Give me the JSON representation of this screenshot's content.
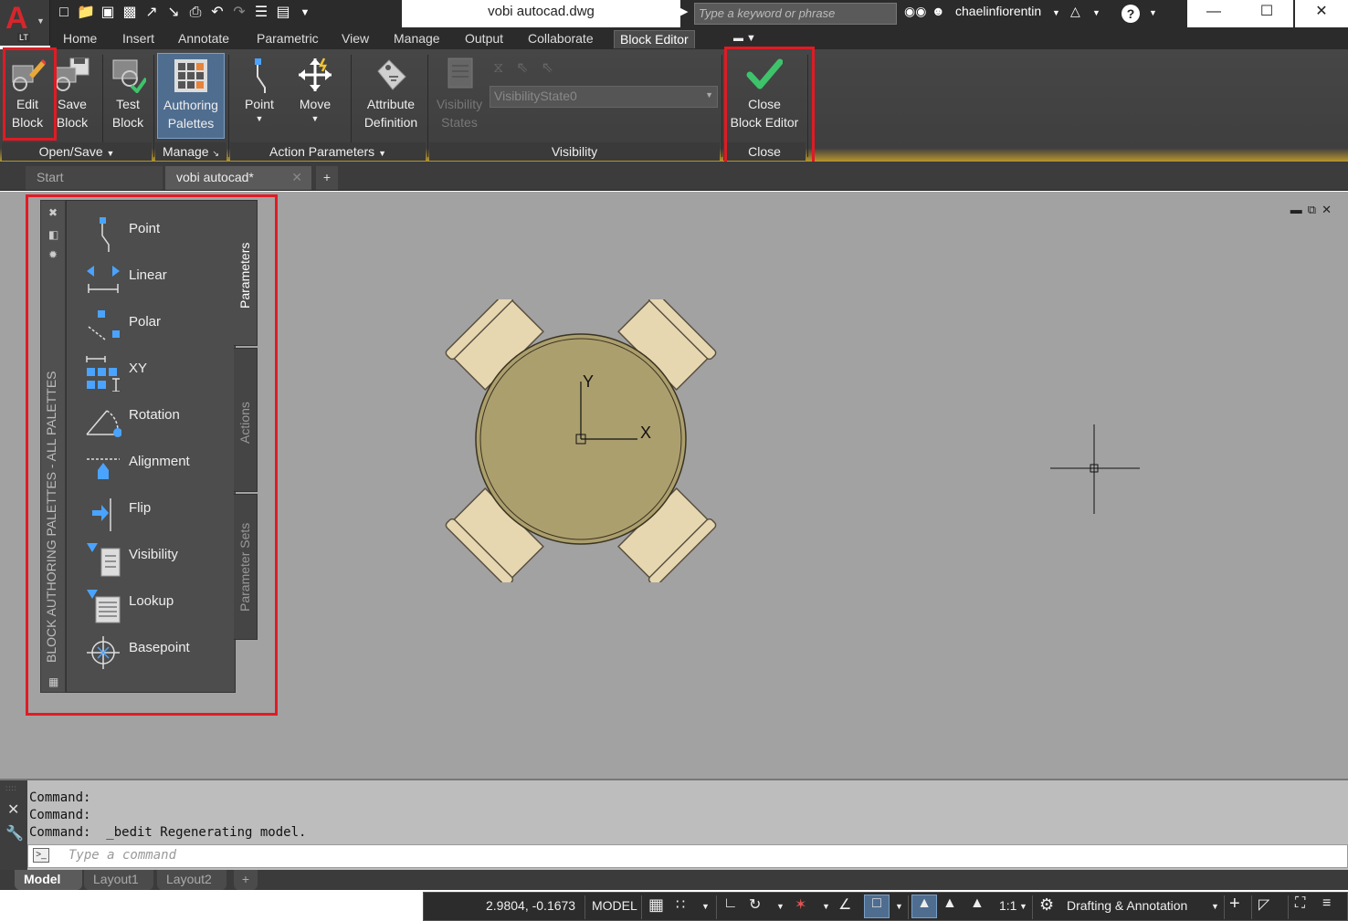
{
  "titlebar": {
    "app_letter": "A",
    "app_edition": "LT",
    "document_title": "vobi autocad.dwg",
    "search_placeholder": "Type a keyword or phrase",
    "username": "chaelinfiorentin"
  },
  "ribbon_tabs": [
    "Home",
    "Insert",
    "Annotate",
    "Parametric",
    "View",
    "Manage",
    "Output",
    "Collaborate",
    "Block Editor"
  ],
  "active_ribbon_tab": "Block Editor",
  "ribbon": {
    "edit_block": [
      "Edit",
      "Block"
    ],
    "save_block": [
      "Save",
      "Block"
    ],
    "test_block": [
      "Test",
      "Block"
    ],
    "authoring_palettes": [
      "Authoring",
      "Palettes"
    ],
    "point": "Point",
    "move": "Move",
    "attribute_definition": [
      "Attribute",
      "Definition"
    ],
    "visibility_states": [
      "Visibility",
      "States"
    ],
    "visibility_state_value": "VisibilityState0",
    "close_block_editor": [
      "Close",
      "Block Editor"
    ],
    "panels": {
      "open_save": "Open/Save",
      "manage": "Manage",
      "action_parameters": "Action Parameters",
      "visibility": "Visibility",
      "close": "Close"
    }
  },
  "file_tabs": {
    "start": "Start",
    "current": "vobi autocad*",
    "add": "+"
  },
  "palette": {
    "title": "BLOCK AUTHORING PALETTES - ALL PALETTES",
    "tabs": [
      "Parameters",
      "Actions",
      "Parameter Sets"
    ],
    "active_tab": "Parameters",
    "items": [
      "Point",
      "Linear",
      "Polar",
      "XY",
      "Rotation",
      "Alignment",
      "Flip",
      "Visibility",
      "Lookup",
      "Basepoint"
    ]
  },
  "drawing": {
    "axis_y": "Y",
    "axis_x": "X",
    "colors": {
      "table": "#ac9f6e",
      "chair": "#e6d7b1",
      "canvas": "#a2a2a2"
    }
  },
  "command": {
    "history": [
      "Command:",
      "Command:",
      "Command:  _bedit Regenerating model."
    ],
    "input_placeholder": "Type a command"
  },
  "layout_tabs": [
    "Model",
    "Layout1",
    "Layout2"
  ],
  "active_layout": "Model",
  "statusbar": {
    "coordinates": "2.9804, -0.1673",
    "space": "MODEL",
    "scale": "1:1",
    "workspace": "Drafting & Annotation"
  },
  "highlight_color": "#e01b24"
}
